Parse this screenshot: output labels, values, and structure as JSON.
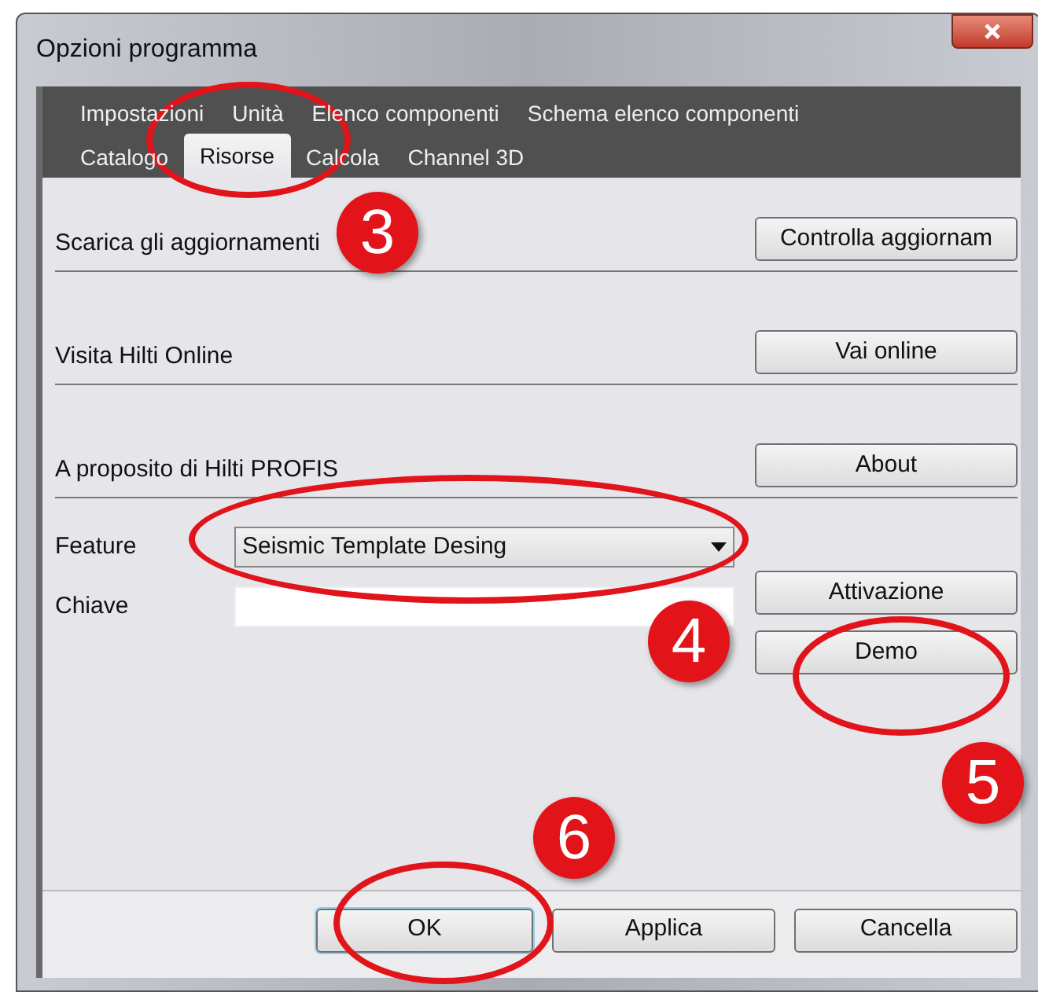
{
  "window": {
    "title": "Opzioni programma"
  },
  "tab_rows": [
    {
      "tabs": [
        {
          "label": "Impostazioni",
          "selected": false
        },
        {
          "label": "Unità",
          "selected": false
        },
        {
          "label": "Elenco componenti",
          "selected": false
        },
        {
          "label": "Schema elenco componenti",
          "selected": false
        }
      ]
    },
    {
      "tabs": [
        {
          "label": "Catalogo",
          "selected": false
        },
        {
          "label": "Risorse",
          "selected": true
        },
        {
          "label": "Calcola",
          "selected": false
        },
        {
          "label": "Channel 3D",
          "selected": false
        }
      ]
    }
  ],
  "sections": [
    {
      "label": "Scarica gli aggiornamenti",
      "button": "Controlla aggiornam"
    },
    {
      "label": "Visita Hilti Online",
      "button": "Vai online"
    },
    {
      "label": "A proposito di Hilti PROFIS",
      "button": "About"
    }
  ],
  "feature": {
    "label": "Feature",
    "value": "Seismic Template Desing"
  },
  "key": {
    "label": "Chiave"
  },
  "license_buttons": [
    "Attivazione",
    "Demo"
  ],
  "footer_buttons": [
    {
      "label": "OK",
      "default": true
    },
    {
      "label": "Applica",
      "default": false
    },
    {
      "label": "Cancella",
      "default": false
    }
  ],
  "annotations": [
    {
      "kind": "ellipse"
    },
    {
      "kind": "badge",
      "text": "3"
    },
    {
      "kind": "ellipse"
    },
    {
      "kind": "badge",
      "text": "4"
    },
    {
      "kind": "ellipse"
    },
    {
      "kind": "badge",
      "text": "5"
    },
    {
      "kind": "ellipse"
    },
    {
      "kind": "badge",
      "text": "6"
    }
  ]
}
